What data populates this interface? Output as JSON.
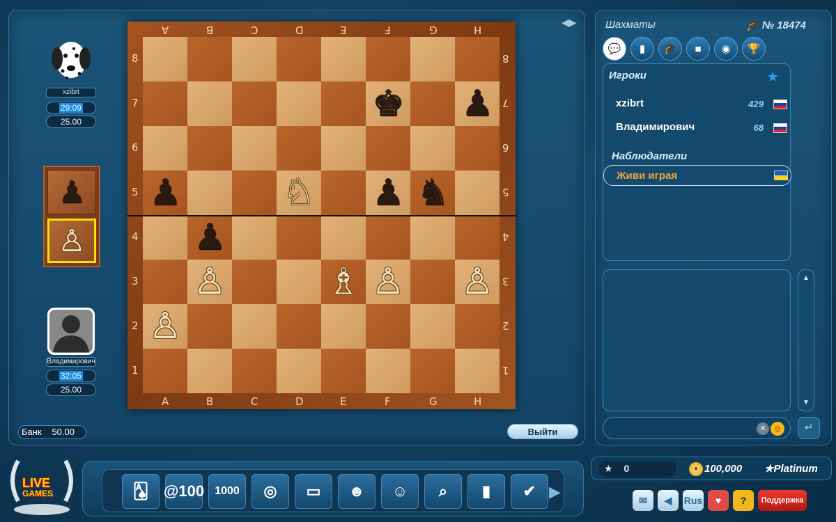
{
  "players": {
    "top": {
      "name": "xzibrt",
      "timer": "29:09",
      "bet": "25.00"
    },
    "bottom": {
      "name": "Владимирович",
      "timer": "32:05",
      "bet": "25.00"
    }
  },
  "captured": {
    "top_piece": "♟",
    "bottom_piece": "♙"
  },
  "bank": {
    "label": "Банк",
    "value": "50.00"
  },
  "exit_label": "Выйти",
  "board": {
    "files_top": [
      "A",
      "B",
      "C",
      "D",
      "E",
      "F",
      "G",
      "H"
    ],
    "files_bottom": [
      "A",
      "B",
      "C",
      "D",
      "E",
      "F",
      "G",
      "H"
    ],
    "ranks": [
      "8",
      "7",
      "6",
      "5",
      "4",
      "3",
      "2",
      "1"
    ],
    "rows": [
      [
        "",
        "",
        "",
        "",
        "",
        "",
        "",
        ""
      ],
      [
        "",
        "",
        "",
        "",
        "",
        "b-king",
        "",
        "b-pawn"
      ],
      [
        "",
        "",
        "",
        "",
        "",
        "",
        "",
        ""
      ],
      [
        "b-pawn",
        "",
        "",
        "w-knight",
        "",
        "b-pawn",
        "b-knight",
        ""
      ],
      [
        "",
        "b-pawn",
        "",
        "",
        "",
        "",
        "",
        ""
      ],
      [
        "",
        "w-pawn",
        "",
        "",
        "w-bishop",
        "w-pawn",
        "",
        "w-pawn"
      ],
      [
        "w-pawn",
        "",
        "",
        "",
        "",
        "",
        "",
        ""
      ],
      [
        "",
        "",
        "",
        "",
        "",
        "",
        "",
        ""
      ]
    ]
  },
  "side": {
    "title": "Шахматы",
    "game_number": "№ 18474",
    "tabs": [
      "chat-icon",
      "stats-icon",
      "cap-icon",
      "video-icon",
      "camera-icon",
      "trophy-icon"
    ],
    "players_heading": "Игроки",
    "player_list": [
      {
        "name": "xzibrt",
        "rating": "429",
        "flag": "ru"
      },
      {
        "name": "Владимирович",
        "rating": "68",
        "flag": "ru"
      }
    ],
    "watchers_heading": "Наблюдатели",
    "watchers": [
      {
        "name": "Живи играя",
        "flag": "ua"
      }
    ]
  },
  "toolbar": {
    "tools": [
      "cards-icon",
      "@100",
      "1000",
      "coin-icon",
      "wallet-icon",
      "faces-icon",
      "group-icon",
      "search-icon",
      "chart-icon",
      "check-icon"
    ]
  },
  "stats": {
    "score": "0",
    "coins": "100,000",
    "level": "Platinum"
  },
  "bottom_buttons": {
    "mail": "mail-icon",
    "sound": "sound-icon",
    "lang": "Rus",
    "fav": "heart-icon",
    "help": "?",
    "support": "Поддержка"
  },
  "logo": {
    "line1": "LIVE",
    "line2": "GAMES"
  }
}
